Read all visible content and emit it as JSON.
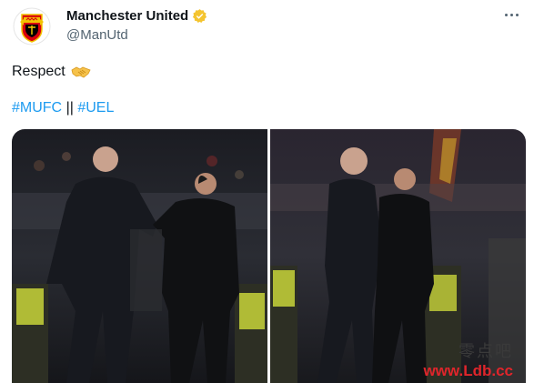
{
  "account": {
    "display_name": "Manchester United",
    "handle": "@ManUtd",
    "verified": true,
    "verified_color": "#f4c430",
    "avatar_icon": "man-utd-crest"
  },
  "tweet": {
    "text": "Respect",
    "emoji": "handshake-icon",
    "hashtag_1": "#MUFC",
    "separator": "||",
    "hashtag_2": "#UEL"
  },
  "media": {
    "count": 2
  },
  "watermark": {
    "top": "零点吧",
    "url": "www.Ldb.cc"
  },
  "colors": {
    "link": "#1d9bf0",
    "text": "#0f1419",
    "secondary": "#536471"
  }
}
